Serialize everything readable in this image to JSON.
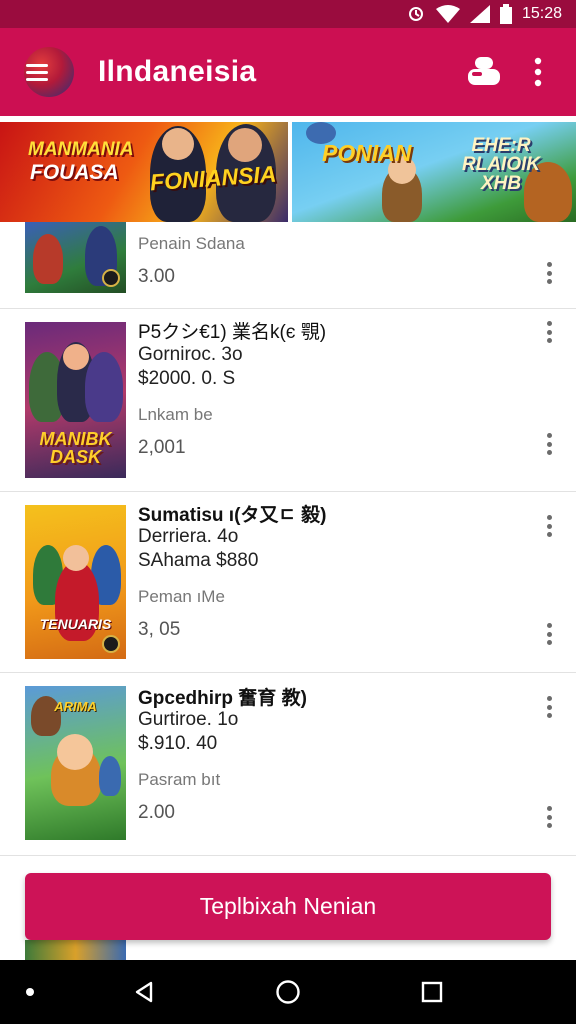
{
  "status_bar": {
    "time": "15:28"
  },
  "app_bar": {
    "title": "Ilndaneisia"
  },
  "banner": {
    "promo_1": {
      "line_1": "MANMANIA",
      "line_2": "FOUASA",
      "line_3": "FONIANSIA"
    },
    "promo_2": {
      "line_1": "PONIAN",
      "line_2": "EHE:R\nRLAIOIK\nXHB"
    }
  },
  "items": [
    {
      "title": "",
      "subtitle": "",
      "price": "",
      "label": "Penain Sdana",
      "value": "3.00"
    },
    {
      "thumb_title": "MANIBK\nDASK",
      "title": "P5クシ€1) 業名k(є 覨)",
      "subtitle": "Gorniroc. 3o",
      "price": "$2000. 0. S",
      "label": "Lnkam be",
      "value": "2,001"
    },
    {
      "thumb_title": "TENUARIS",
      "title": "Sumatisu ı(タ又ㄷ 毅)",
      "subtitle": "Derriera. 4o",
      "price": "SAhama  $880",
      "label": "Peman ıMe",
      "value": "3, 05"
    },
    {
      "thumb_title": "ARIMA",
      "title": "Gpcedhirp 奮育 教)",
      "subtitle": "Gurtiroe. 1o",
      "price": "$.910. 40",
      "label": "Pasram bıt",
      "value": "2.00"
    }
  ],
  "cta": {
    "label": "Teplbixah Nenian"
  },
  "colors": {
    "primary": "#cc0f52",
    "status_bar": "#9a0c3e",
    "nav_bar": "#000000"
  },
  "icons": [
    "wifi-icon",
    "signal-icon",
    "battery-icon",
    "menu-icon",
    "profile-icon",
    "more-vert-icon",
    "back-icon",
    "home-icon",
    "recents-icon"
  ]
}
